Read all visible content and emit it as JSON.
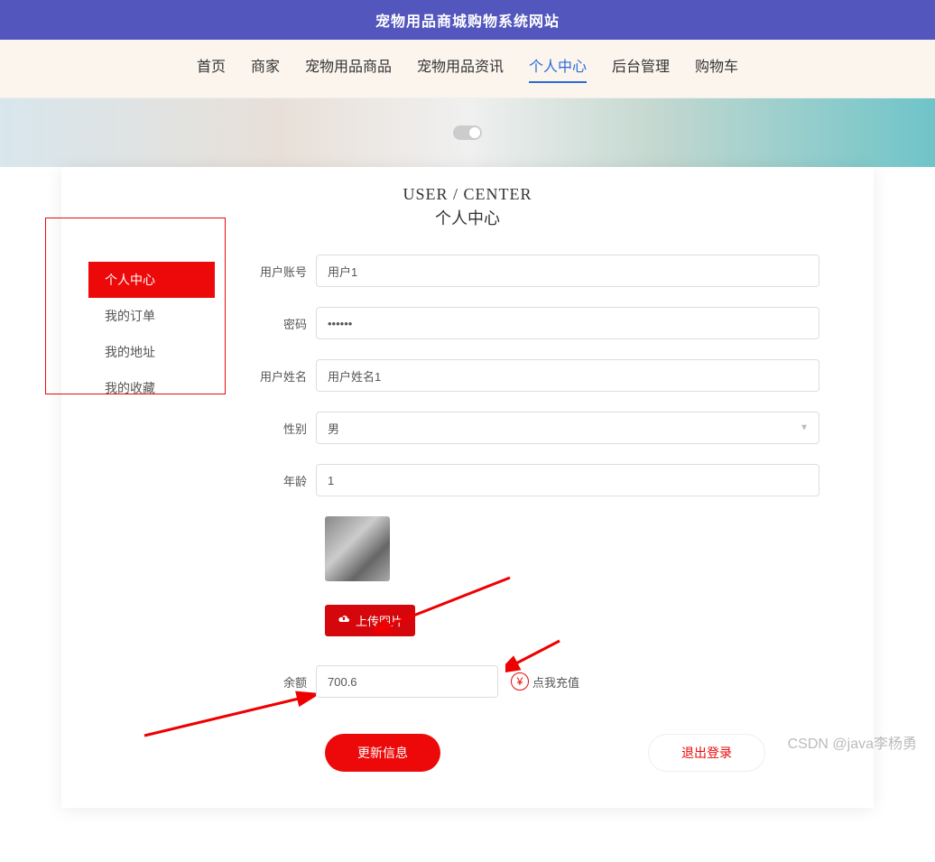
{
  "header": {
    "title": "宠物用品商城购物系统网站"
  },
  "nav": {
    "items": [
      {
        "label": "首页"
      },
      {
        "label": "商家"
      },
      {
        "label": "宠物用品商品"
      },
      {
        "label": "宠物用品资讯"
      },
      {
        "label": "个人中心",
        "active": true
      },
      {
        "label": "后台管理"
      },
      {
        "label": "购物车"
      }
    ]
  },
  "page": {
    "title_en": "USER / CENTER",
    "title_cn": "个人中心"
  },
  "sidebar": {
    "items": [
      {
        "label": "个人中心",
        "active": true
      },
      {
        "label": "我的订单"
      },
      {
        "label": "我的地址"
      },
      {
        "label": "我的收藏"
      }
    ]
  },
  "form": {
    "account": {
      "label": "用户账号",
      "value": "用户1"
    },
    "password": {
      "label": "密码",
      "value": "••••••"
    },
    "name": {
      "label": "用户姓名",
      "value": "用户姓名1"
    },
    "gender": {
      "label": "性别",
      "value": "男"
    },
    "age": {
      "label": "年龄",
      "value": "1"
    },
    "upload": {
      "label": "上传图片"
    },
    "balance": {
      "label": "余额",
      "value": "700.6"
    },
    "recharge": {
      "label": "点我充值",
      "icon": "¥"
    },
    "update": {
      "label": "更新信息"
    },
    "logout": {
      "label": "退出登录"
    }
  },
  "watermark": "CSDN @java李杨勇"
}
